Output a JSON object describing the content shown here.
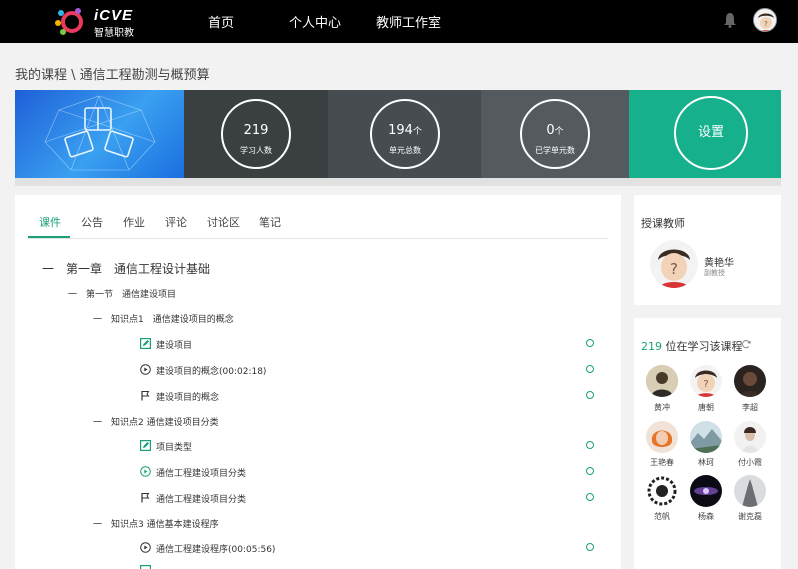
{
  "nav": {
    "logo_text": "iCVE",
    "logo_sub": "智慧职教",
    "items": [
      "首页",
      "个人中心",
      "教师工作室"
    ]
  },
  "breadcrumb": "我的课程 \\ 通信工程勘测与概预算",
  "stats": [
    {
      "value": "219",
      "unit": "",
      "label": "学习人数"
    },
    {
      "value": "194",
      "unit": "个",
      "label": "单元总数"
    },
    {
      "value": "0",
      "unit": "个",
      "label": "已学单元数"
    }
  ],
  "settings_label": "设置",
  "tabs": [
    "课件",
    "公告",
    "作业",
    "评论",
    "讨论区",
    "笔记"
  ],
  "outline": {
    "chapter": "一　第一章　通信工程设计基础",
    "section": "一　第一节　通信建设项目",
    "kp1": "一　知识点1　通信建设项目的概念",
    "kp1_items": [
      "建设项目",
      "建设项目的概念(00:02:18)",
      "建设项目的概念"
    ],
    "kp2": "一　知识点2 通信建设项目分类",
    "kp2_items": [
      "项目类型",
      "通信工程建设项目分类",
      "通信工程建设项目分类"
    ],
    "kp3": "一　知识点3 通信基本建设程序",
    "kp3_items": [
      "通信工程建设程序(00:05:56)"
    ]
  },
  "teacher": {
    "title": "授课教师",
    "name": "黄艳华",
    "role": "副教授"
  },
  "learners": {
    "count": "219",
    "title_suffix": " 位在学习该课程",
    "names": [
      "黄冲",
      "唐朝",
      "李超",
      "王艳春",
      "林珂",
      "付小霞",
      "范帆",
      "杨森",
      "谢克磊"
    ]
  },
  "colors": {
    "accent": "#1aa07a",
    "stat_bg_1": "#3a3f42",
    "stat_bg_2": "#474c50",
    "stat_bg_3": "#555a5e",
    "settings_bg": "#16b08c"
  }
}
